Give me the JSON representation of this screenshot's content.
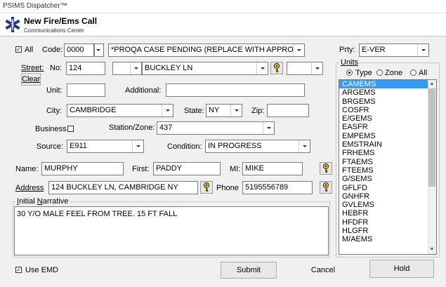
{
  "window": {
    "title": "PSIMS Dispatcher™"
  },
  "header": {
    "title": "New Fire/Ems Call",
    "subtitle": "Communications Center"
  },
  "top": {
    "all_label": "All",
    "all_checked": true,
    "code_label": "Code:",
    "code_value": "0000",
    "code_desc": "*PROQA CASE PENDING (REPLACE WITH APPROPR",
    "prty_label": "Prty:",
    "prty_value": "E-VER"
  },
  "street": {
    "label": "Street:",
    "no_label": "No:",
    "no_value": "124",
    "prefix_value": "",
    "name_value": "BUCKLEY LN",
    "suffix_value": "",
    "clear_label": "Clear",
    "unit_label": "Unit:",
    "unit_value": "",
    "additional_label": "Additional:",
    "additional_value": ""
  },
  "location": {
    "city_label": "City:",
    "city_value": "CAMBRIDGE",
    "state_label": "State:",
    "state_value": "NY",
    "zip_label": "Zip:",
    "zip_value": "",
    "business_label": "Business",
    "station_label": "Station/Zone:",
    "station_value": "437",
    "source_label": "Source:",
    "source_value": "E911",
    "condition_label": "Condition:",
    "condition_value": "IN PROGRESS"
  },
  "caller": {
    "name_label": "Name:",
    "name_value": "MURPHY",
    "first_label": "First:",
    "first_value": "PADDY",
    "mi_label": "MI:",
    "mi_value": "MIKE",
    "address_label": "Address",
    "address_value": "124 BUCKLEY LN, CAMBRIDGE NY",
    "phone_label": "Phone",
    "phone_value": "5195556789"
  },
  "narrative": {
    "label": "Initial Narrative",
    "text": "30 Y/O MALE FEEL FROM TREE. 15 FT FALL"
  },
  "units": {
    "label": "Units",
    "type_label": "Type",
    "zone_label": "Zone",
    "all_label": "All",
    "items": [
      "CAMEMS",
      "ARGEMS",
      "BRGEMS",
      "COSFR",
      "E/GEMS",
      "EASFR",
      "EMPEMS",
      "EMSTRAIN",
      "FRHEMS",
      "FTAEMS",
      "FTEEMS",
      "G/SEMS",
      "GFLFD",
      "GNHFR",
      "GVLEMS",
      "HEBFR",
      "HFDFR",
      "HLGFR",
      "M/AEMS"
    ],
    "selected_index": 0
  },
  "bottom": {
    "use_emd_label": "Use EMD",
    "use_emd_checked": true,
    "submit_label": "Submit",
    "cancel_label": "Cancel",
    "hold_label": "Hold"
  },
  "colors": {
    "selection": "#3399ff",
    "key_icon": "#f2c200"
  }
}
